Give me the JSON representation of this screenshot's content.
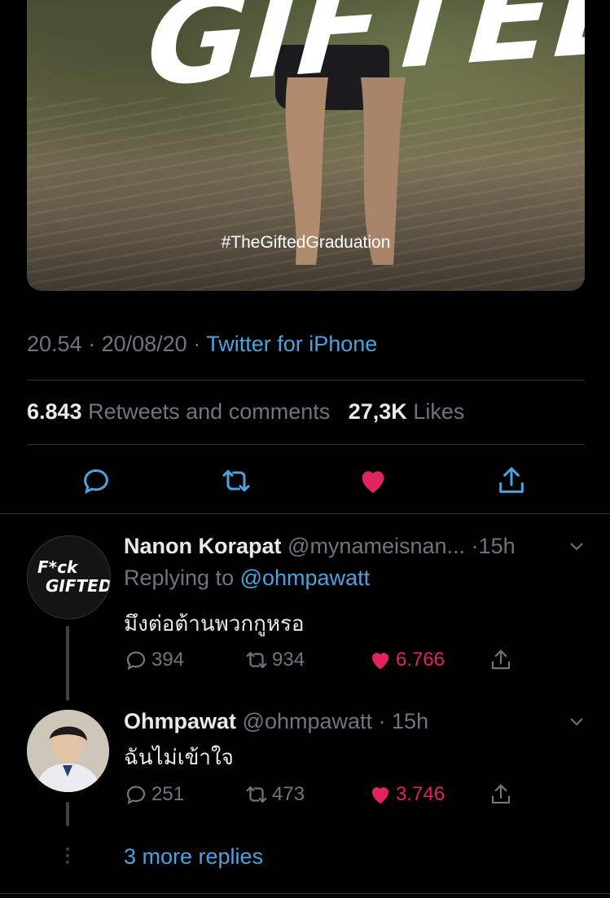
{
  "media": {
    "overlay_title": "GIFTED",
    "overlay_hashtag": "#TheGiftedGraduation"
  },
  "tweet": {
    "time": "20.54",
    "date": "20/08/20",
    "source": "Twitter for iPhone",
    "retweets_count": "6.843",
    "retweets_label": "Retweets and comments",
    "likes_count": "27,3K",
    "likes_label": "Likes",
    "liked": true,
    "colors": {
      "accent": "#4aa3df",
      "like": "#e0245e",
      "muted": "#6e767d"
    }
  },
  "replies": [
    {
      "name": "Nanon Korapat",
      "handle": "@mynameisnan...",
      "time": "15h",
      "replying_to_label": "Replying to",
      "replying_to": "@ohmpawatt",
      "text": "มึงต่อต้านพวกกูหรอ",
      "comments": "394",
      "retweets": "934",
      "likes": "6.766",
      "avatar_text_1": "F*ck",
      "avatar_text_2": "GIFTED"
    },
    {
      "name": "Ohmpawat",
      "handle": "@ohmpawatt",
      "time": "15h",
      "text": "ฉันไม่เข้าใจ",
      "comments": "251",
      "retweets": "473",
      "likes": "3.746"
    }
  ],
  "more_replies": "3 more replies"
}
